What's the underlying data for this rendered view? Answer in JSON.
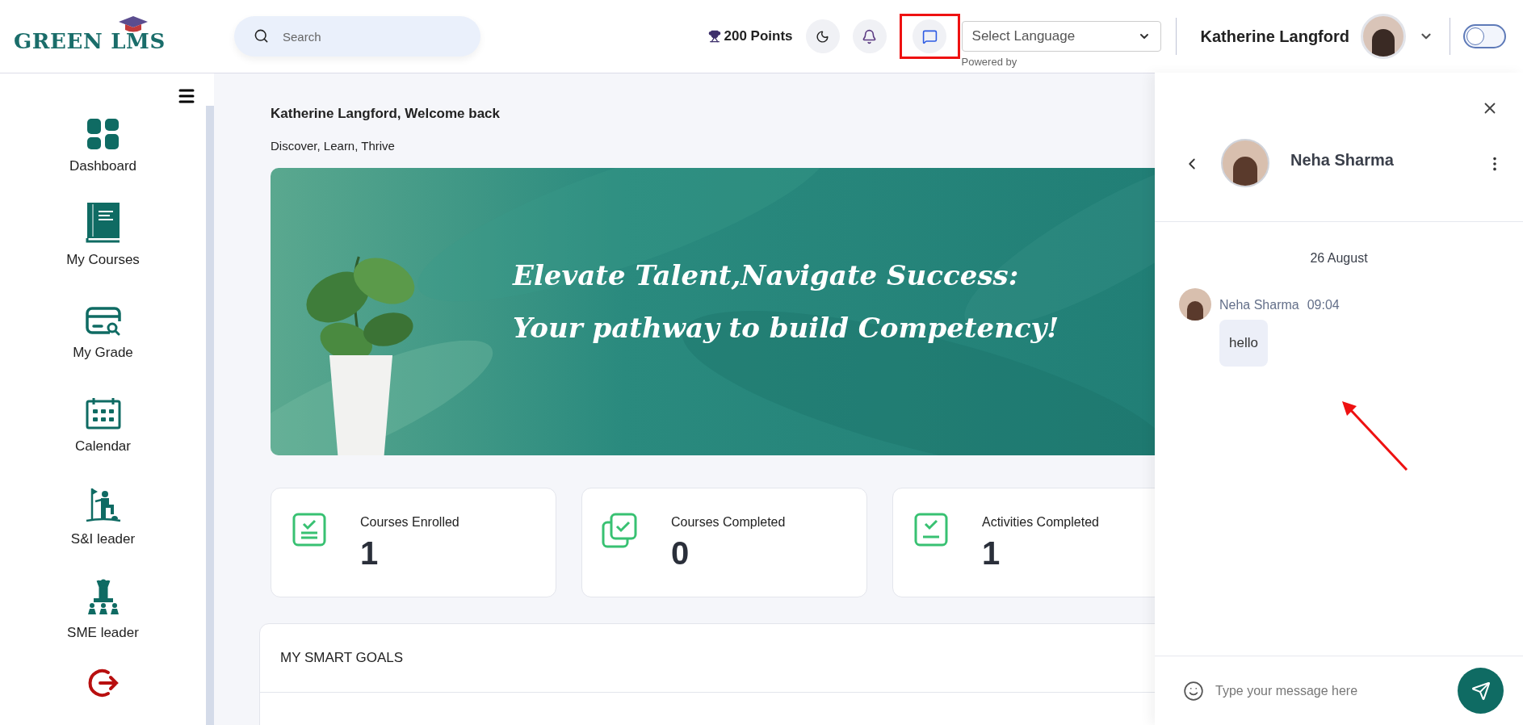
{
  "header": {
    "logo": "GREEN LMS",
    "search": {
      "placeholder": "Search"
    },
    "points": "200 Points",
    "language_select": {
      "value": "Select Language",
      "note": "Powered by"
    },
    "user_name": "Katherine Langford",
    "theme_toggle": {
      "on": false
    }
  },
  "sidebar": {
    "items": [
      {
        "label": "Dashboard"
      },
      {
        "label": "My Courses"
      },
      {
        "label": "My Grade"
      },
      {
        "label": "Calendar"
      },
      {
        "label": "S&I leader"
      },
      {
        "label": "SME leader"
      }
    ]
  },
  "main": {
    "greeting": "Katherine Langford, Welcome back",
    "tagline": "Discover, Learn, Thrive",
    "banner": {
      "line_1": "Elevate Talent,Navigate Success:",
      "line_2": "Your pathway to build Competency!"
    },
    "stats": [
      {
        "label": "Courses Enrolled",
        "value": "1"
      },
      {
        "label": "Courses Completed",
        "value": "0"
      },
      {
        "label": "Activities Completed",
        "value": "1"
      }
    ],
    "goals_title": "MY SMART GOALS"
  },
  "chat": {
    "contact_name": "Neha Sharma",
    "date": "26 August",
    "messages": [
      {
        "sender": "Neha Sharma",
        "time": "09:04",
        "text": "hello"
      }
    ],
    "input": {
      "placeholder": "Type your message here"
    }
  }
}
